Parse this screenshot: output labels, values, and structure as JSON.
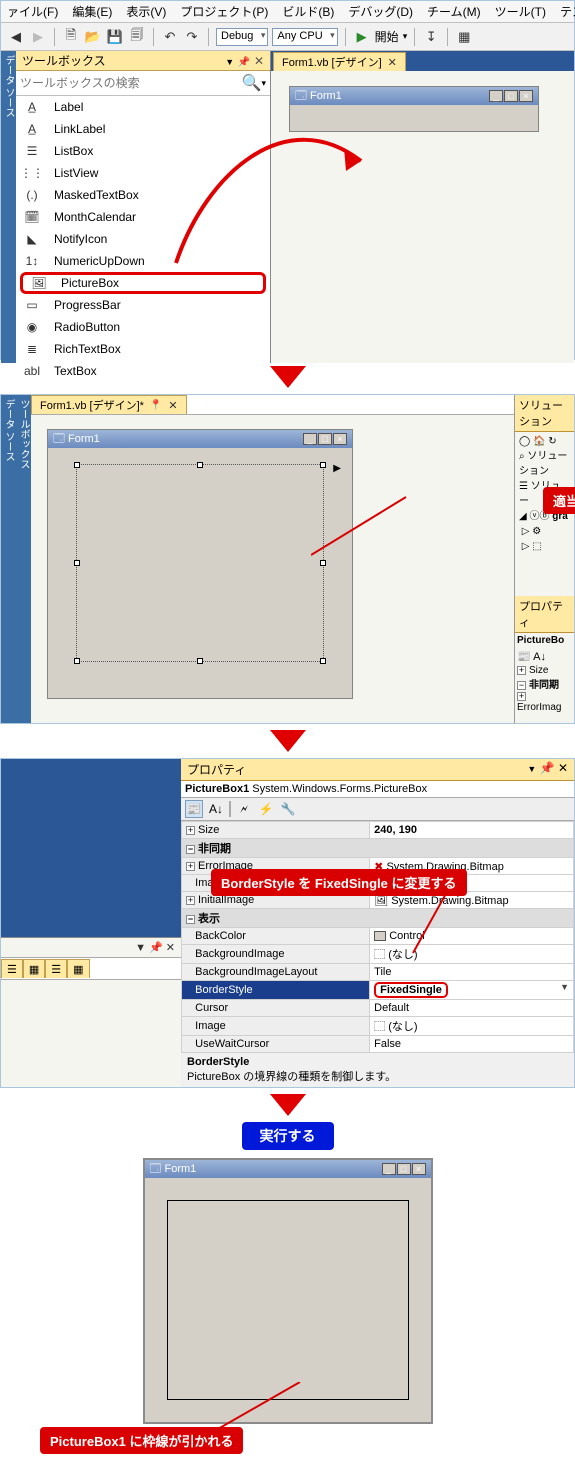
{
  "menu": {
    "file": "ァイル(F)",
    "edit": "編集(E)",
    "view": "表示(V)",
    "project": "プロジェクト(P)",
    "build": "ビルド(B)",
    "debug": "デバッグ(D)",
    "team": "チーム(M)",
    "tool": "ツール(T)",
    "test": "テスト(S"
  },
  "toolbar": {
    "config": "Debug",
    "platform": "Any CPU",
    "start": "開始"
  },
  "sidetabs": {
    "datasource": "データ ソース",
    "toolbox": "ツールボックス"
  },
  "toolbox": {
    "title": "ツールボックス",
    "search_ph": "ツールボックスの検索",
    "items": [
      {
        "icon": "A̲",
        "label": "Label"
      },
      {
        "icon": "A̲",
        "label": "LinkLabel"
      },
      {
        "icon": "☰",
        "label": "ListBox"
      },
      {
        "icon": "⋮⋮",
        "label": "ListView"
      },
      {
        "icon": "(.)",
        "label": "MaskedTextBox"
      },
      {
        "icon": "🗓",
        "label": "MonthCalendar"
      },
      {
        "icon": "◣",
        "label": "NotifyIcon"
      },
      {
        "icon": "1↕",
        "label": "NumericUpDown"
      },
      {
        "icon": "🖼",
        "label": "PictureBox"
      },
      {
        "icon": "▭",
        "label": "ProgressBar"
      },
      {
        "icon": "◉",
        "label": "RadioButton"
      },
      {
        "icon": "≣",
        "label": "RichTextBox"
      },
      {
        "icon": "abl",
        "label": "TextBox"
      }
    ],
    "highlight_index": 8
  },
  "tabs": {
    "design": "Form1.vb [デザイン]",
    "design_dirty": "Form1.vb [デザイン]*"
  },
  "form": {
    "title": "Form1"
  },
  "callouts": {
    "place": "適当に配置する",
    "border": "BorderStyle を FixedSingle に変更する",
    "run": "実行する",
    "result": "PictureBox1 に枠線が引かれる"
  },
  "solex": {
    "title": "ソリューション",
    "search": "ソリューション",
    "node": "ソリュー",
    "proj": "gra"
  },
  "prop": {
    "title": "プロパティ",
    "object": "PictureBox1",
    "objtype": "System.Windows.Forms.PictureBox",
    "rows": {
      "size_k": "Size",
      "size_v": "240, 190",
      "cat_async": "非同期",
      "err_k": "ErrorImage",
      "err_v": "System.Drawing.Bitmap",
      "imgloc_k": "ImageLocation",
      "imgloc_v": "",
      "init_k": "InitialImage",
      "init_v": "System.Drawing.Bitmap",
      "cat_disp": "表示",
      "back_k": "BackColor",
      "back_v": "Control",
      "bimg_k": "BackgroundImage",
      "bimg_v": "(なし)",
      "blay_k": "BackgroundImageLayout",
      "blay_v": "Tile",
      "bs_k": "BorderStyle",
      "bs_v": "FixedSingle",
      "cur_k": "Cursor",
      "cur_v": "Default",
      "img_k": "Image",
      "img_v": "(なし)",
      "wait_k": "UseWaitCursor",
      "wait_v": "False"
    },
    "desc_title": "BorderStyle",
    "desc_body": "PictureBox の境界線の種類を制御します。",
    "mini_rows": {
      "size": "Size",
      "async": "非同期",
      "err": "ErrorImag"
    },
    "mini_obj": "PictureBo"
  }
}
